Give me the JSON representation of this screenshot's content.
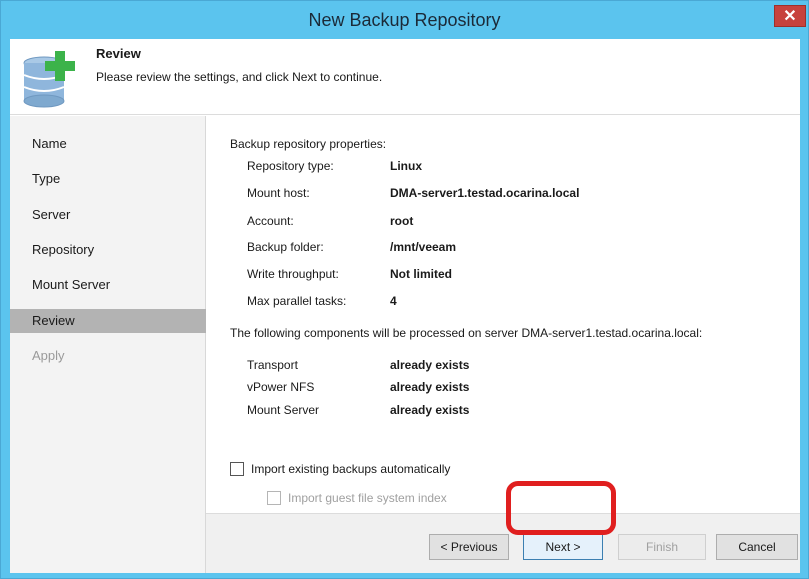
{
  "window": {
    "title": "New Backup Repository",
    "close_glyph": "✕"
  },
  "header": {
    "title": "Review",
    "description": "Please review the settings, and click Next to continue.",
    "icon": "database-add-icon"
  },
  "nav": {
    "items": [
      {
        "label": "Name"
      },
      {
        "label": "Type"
      },
      {
        "label": "Server"
      },
      {
        "label": "Repository"
      },
      {
        "label": "Mount Server"
      },
      {
        "label": "Review"
      },
      {
        "label": "Apply"
      }
    ]
  },
  "review": {
    "properties_heading": "Backup repository properties:",
    "properties": [
      {
        "label": "Repository type:",
        "value": "Linux"
      },
      {
        "label": "Mount host:",
        "value": "DMA-server1.testad.ocarina.local"
      },
      {
        "label": "Account:",
        "value": "root"
      },
      {
        "label": "Backup folder:",
        "value": "/mnt/veeam"
      },
      {
        "label": "Write throughput:",
        "value": "Not limited"
      },
      {
        "label": "Max parallel tasks:",
        "value": "4"
      }
    ],
    "components_heading": "The following components will be processed on server DMA-server1.testad.ocarina.local:",
    "components": [
      {
        "label": "Transport",
        "value": "already exists"
      },
      {
        "label": "vPower NFS",
        "value": "already exists"
      },
      {
        "label": "Mount Server",
        "value": "already exists"
      }
    ],
    "import_backups_label": "Import existing backups automatically",
    "import_index_label": "Import guest file system index"
  },
  "buttons": {
    "previous": "< Previous",
    "next": "Next >",
    "finish": "Finish",
    "cancel": "Cancel"
  },
  "colors": {
    "title_bar": "#5bc4ee",
    "highlight": "#e01f1f",
    "nav_selected": "#b3b3b3",
    "icon_plus": "#3cb34a",
    "icon_db": "#7fa9cf"
  }
}
